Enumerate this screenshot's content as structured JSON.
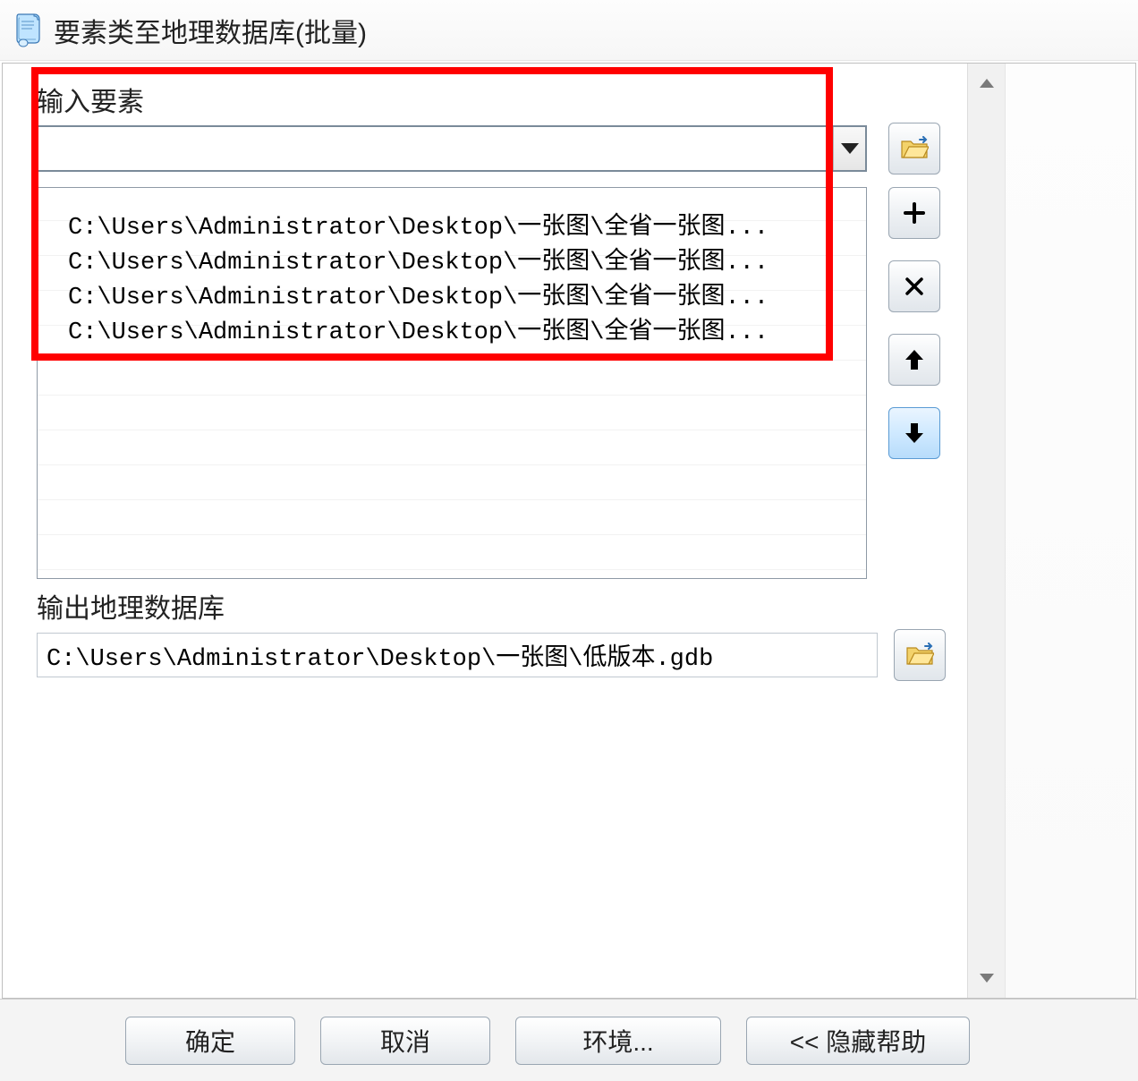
{
  "window": {
    "title": "要素类至地理数据库(批量)"
  },
  "input_section": {
    "label": "输入要素",
    "combo_value": "",
    "items": [
      "C:\\Users\\Administrator\\Desktop\\一张图\\全省一张图...",
      "C:\\Users\\Administrator\\Desktop\\一张图\\全省一张图...",
      "C:\\Users\\Administrator\\Desktop\\一张图\\全省一张图...",
      "C:\\Users\\Administrator\\Desktop\\一张图\\全省一张图..."
    ]
  },
  "output_section": {
    "label": "输出地理数据库",
    "value": "C:\\Users\\Administrator\\Desktop\\一张图\\低版本.gdb"
  },
  "buttons": {
    "ok": "确定",
    "cancel": "取消",
    "environments": "环境...",
    "hide_help": "<< 隐藏帮助"
  },
  "icons": {
    "browse": "folder-open-icon",
    "add": "plus-icon",
    "remove": "x-icon",
    "move_up": "arrow-up-icon",
    "move_down": "arrow-down-icon",
    "scroll_up": "chevron-up-icon",
    "scroll_down": "chevron-down-icon",
    "dropdown": "triangle-down-icon"
  }
}
